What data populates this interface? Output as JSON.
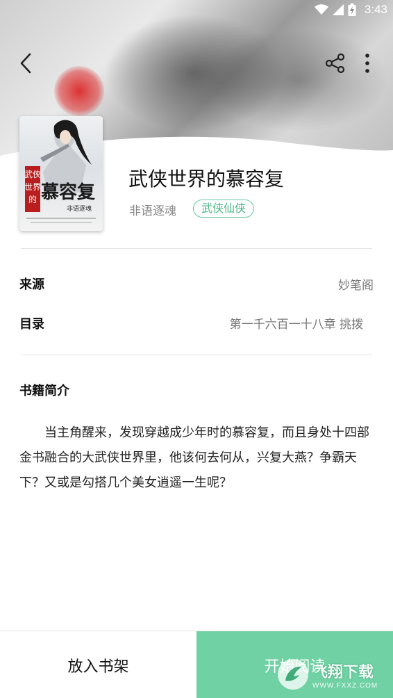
{
  "status_bar": {
    "time": "3:43",
    "icons": [
      "wifi-icon",
      "cellular-signal-icon",
      "battery-charging-icon"
    ]
  },
  "toolbar": {
    "back_icon": "chevron-left-icon",
    "share_icon": "share-icon",
    "more_icon": "more-vertical-icon"
  },
  "book": {
    "title": "武侠世界的慕容复",
    "author": "非语逐魂",
    "genre": "武侠仙侠",
    "cover": {
      "title_chars": "武侠世界的",
      "title_big": "慕容复",
      "author": "非语逐魂"
    }
  },
  "details": {
    "source_label": "来源",
    "source_value": "妙笔阁",
    "toc_label": "目录",
    "toc_value": "第一千六百一十八章 挑拨"
  },
  "intro": {
    "title": "书籍简介",
    "text": "当主角醒来，发现穿越成少年时的慕容复，而且身处十四部金书融合的大武侠世界里，他该何去何从，兴复大燕？争霸天下？又或是勾搭几个美女逍遥一生呢？"
  },
  "bottom": {
    "add_shelf": "放入书架",
    "start_reading": "开始阅读"
  },
  "watermark": {
    "name": "飞翔下载",
    "url": "WWW.FXXZ.COM"
  },
  "colors": {
    "accent": "#6fd1a4",
    "tag": "#4cb786"
  }
}
